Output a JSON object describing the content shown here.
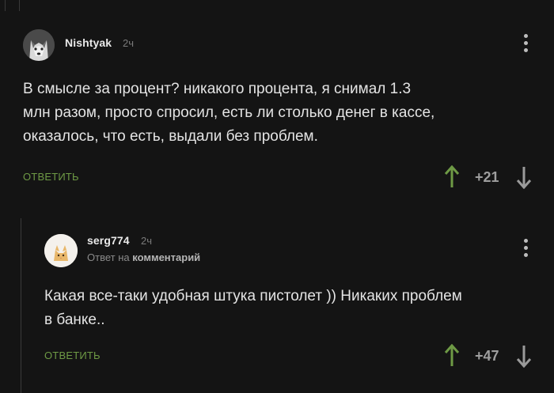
{
  "colors": {
    "background": "#141414",
    "reply_green": "#6e9a45",
    "upvote_green": "#6e9a45",
    "downvote_gray": "#9a9a9a",
    "thread_line": "#3a3a3a"
  },
  "comments": [
    {
      "username": "Nishtyak",
      "time": "2ч",
      "lines": [
        "В смысле за процент? никакого процента, я снимал 1.3",
        "млн разом, просто спросил, есть ли столько денег в кассе,",
        "оказалось, что есть, выдали без проблем."
      ],
      "reply_label": "ОТВЕТИТЬ",
      "rating": "+21",
      "avatar_icon": "husky-avatar-icon"
    },
    {
      "username": "serg774",
      "time": "2ч",
      "reply_to_prefix": "Ответ на",
      "reply_to_target": "комментарий",
      "lines": [
        "Какая все-таки удобная штука пистолет )) Никаких проблем",
        "в банке.."
      ],
      "reply_label": "ОТВЕТИТЬ",
      "rating": "+47",
      "avatar_icon": "cat-avatar-icon"
    }
  ],
  "icons": {
    "menu": "more-vertical-icon",
    "upvote": "arrow-up-icon",
    "downvote": "arrow-down-icon"
  }
}
